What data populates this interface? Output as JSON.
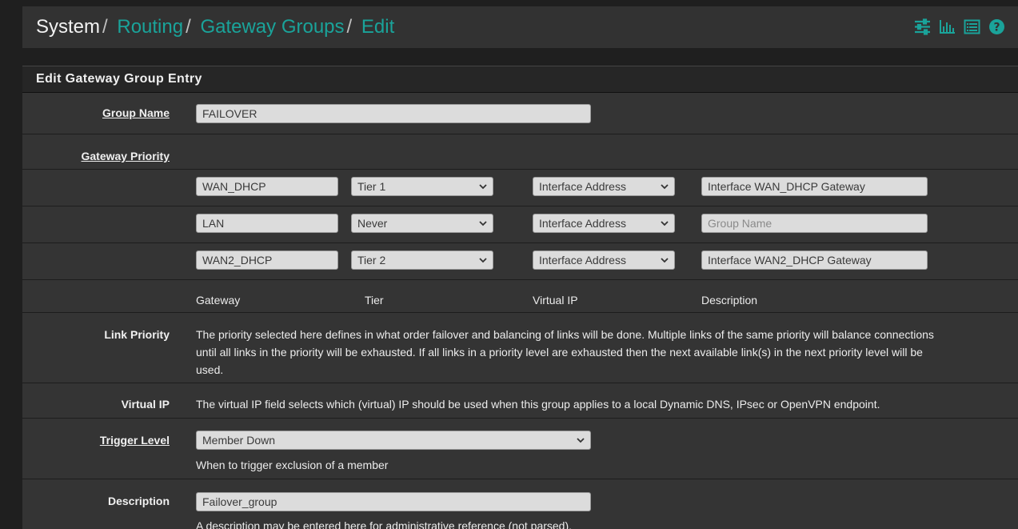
{
  "breadcrumb": {
    "root": "System",
    "items": [
      "Routing",
      "Gateway Groups",
      "Edit"
    ]
  },
  "header_icons": [
    "sliders-icon",
    "bar-chart-icon",
    "list-icon",
    "help-icon"
  ],
  "accent_color": "#1aa39a",
  "panel": {
    "title": "Edit Gateway Group Entry"
  },
  "group_name": {
    "label": "Group Name",
    "value": "FAILOVER"
  },
  "gateway_priority": {
    "label": "Gateway Priority",
    "rows": [
      {
        "gateway": "WAN_DHCP",
        "tier": "Tier 1",
        "vip": "Interface Address",
        "description": "Interface WAN_DHCP Gateway",
        "description_placeholder": ""
      },
      {
        "gateway": "LAN",
        "tier": "Never",
        "vip": "Interface Address",
        "description": "",
        "description_placeholder": "Group Name"
      },
      {
        "gateway": "WAN2_DHCP",
        "tier": "Tier 2",
        "vip": "Interface Address",
        "description": "Interface WAN2_DHCP Gateway",
        "description_placeholder": ""
      }
    ],
    "columns": [
      "Gateway",
      "Tier",
      "Virtual IP",
      "Description"
    ]
  },
  "link_priority": {
    "label": "Link Priority",
    "line1": "The priority selected here defines in what order failover and balancing of links will be done. Multiple links of the same priority will balance connections",
    "line2": "until all links in the priority will be exhausted. If all links in a priority level are exhausted then the next available link(s) in the next priority level will be",
    "line3": "used."
  },
  "virtual_ip": {
    "label": "Virtual IP",
    "text": "The virtual IP field selects which (virtual) IP should be used when this group applies to a local Dynamic DNS, IPsec or OpenVPN endpoint."
  },
  "trigger_level": {
    "label": "Trigger Level",
    "value": "Member Down",
    "help": "When to trigger exclusion of a member"
  },
  "description": {
    "label": "Description",
    "value": "Failover_group",
    "help": "A description may be entered here for administrative reference (not parsed)."
  }
}
